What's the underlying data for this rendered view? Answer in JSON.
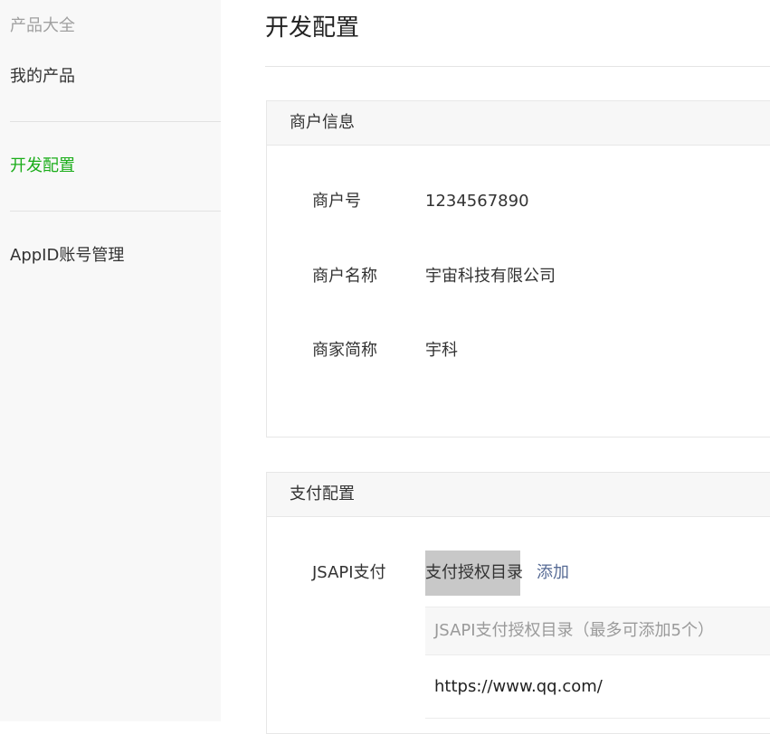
{
  "sidebar": {
    "header": "产品大全",
    "items": [
      {
        "label": "我的产品"
      },
      {
        "label": "开发配置"
      },
      {
        "label": "AppID账号管理"
      }
    ],
    "active_color": "#1aad19"
  },
  "main": {
    "title": "开发配置",
    "merchant_panel": {
      "title": "商户信息",
      "rows": [
        {
          "label": "商户号",
          "value": "1234567890"
        },
        {
          "label": "商户名称",
          "value": "宇宙科技有限公司"
        },
        {
          "label": "商家简称",
          "value": "宇科"
        }
      ]
    },
    "payment_panel": {
      "title": "支付配置",
      "jsapi_label": "JSAPI支付",
      "dir_tab_label": "支付授权目录",
      "add_link_label": "添加",
      "table_header": "JSAPI支付授权目录（最多可添加5个）",
      "directories": [
        "https://www.qq.com/"
      ]
    }
  },
  "colors": {
    "link": "#576b95",
    "sidebar_bg": "#f8f8f8",
    "panel_head_bg": "#f7f7f7"
  }
}
